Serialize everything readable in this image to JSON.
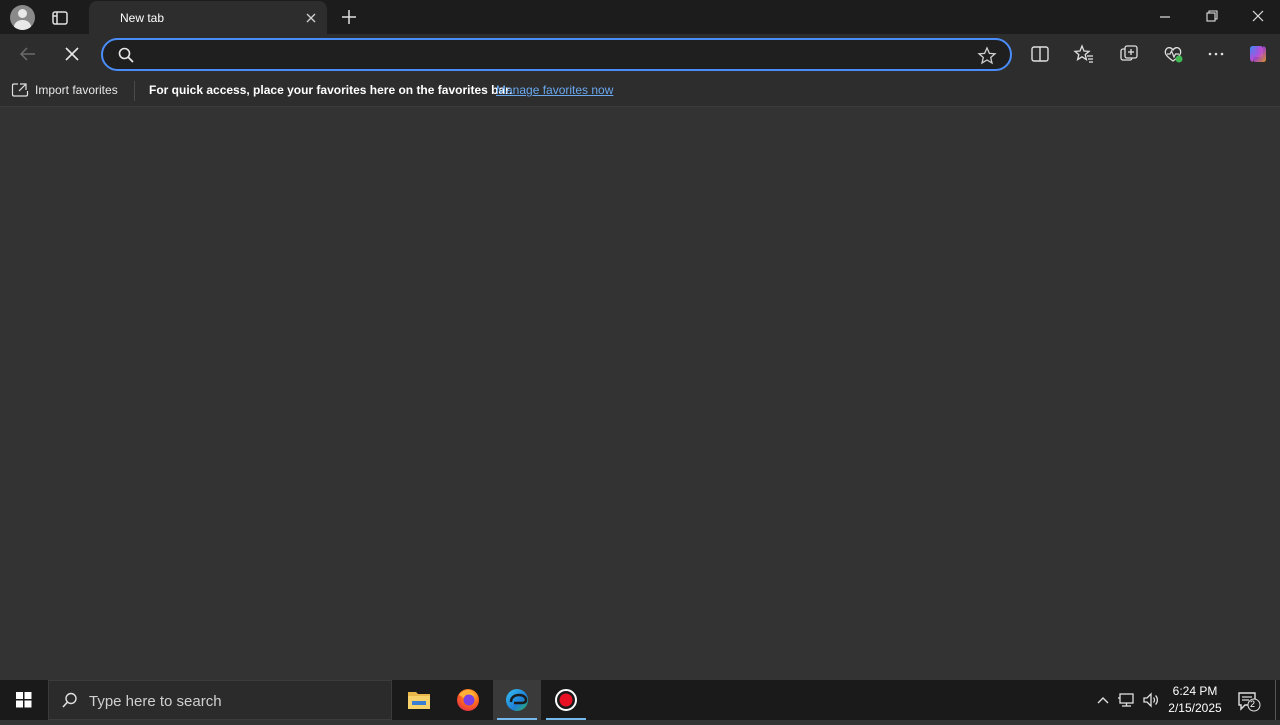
{
  "browser": {
    "tab": {
      "title": "New tab"
    },
    "address_bar": {
      "value": "",
      "placeholder": ""
    },
    "favorites_bar": {
      "import_label": "Import favorites",
      "message": "For quick access, place your favorites here on the favorites bar.",
      "manage_link": "Manage favorites now"
    },
    "colors": {
      "accent": "#4a8df8",
      "link": "#6aa8f0",
      "background": "#333333"
    }
  },
  "taskbar": {
    "search_placeholder": "Type here to search",
    "clock": {
      "time": "6:24 PM",
      "date": "2/15/2025"
    },
    "notification_count": "2",
    "apps": [
      "file-explorer",
      "firefox",
      "edge",
      "recorder"
    ]
  }
}
